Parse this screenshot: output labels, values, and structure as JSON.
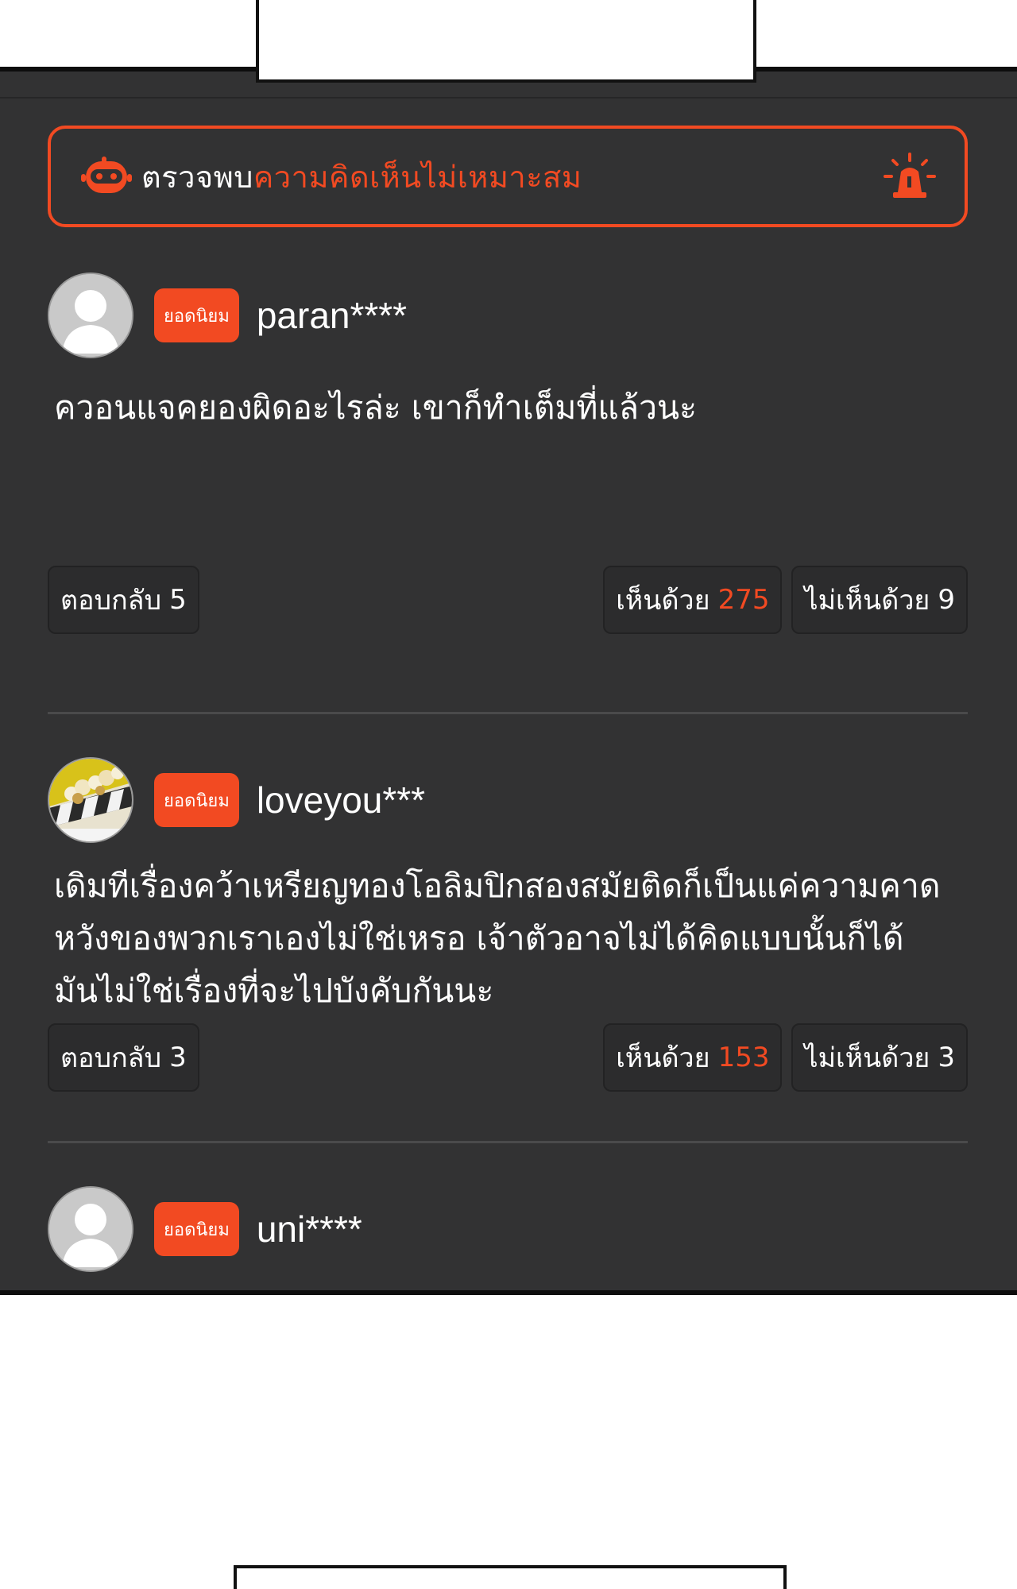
{
  "warning": {
    "prefix": "ตรวจพบ",
    "highlight": "ความคิดเห็นไม่เหมาะสม",
    "robot_icon": "robot-icon",
    "siren_icon": "siren-icon"
  },
  "comments": [
    {
      "avatar": "default-avatar",
      "badge": "ยอดนิยม",
      "username": "paran****",
      "text": "ควอนแจคยองผิดอะไรล่ะ เขาก็ทำเต็มที่แล้วนะ",
      "reply_label": "ตอบกลับ",
      "reply_count": "5",
      "agree_label": "เห็นด้วย",
      "agree_count": "275",
      "disagree_label": "ไม่เห็นด้วย",
      "disagree_count": "9"
    },
    {
      "avatar": "popcorn-clapperboard-avatar",
      "badge": "ยอดนิยม",
      "username": "loveyou***",
      "text": "เดิมทีเรื่องคว้าเหรียญทองโอลิมปิกสองสมัยติดก็เป็นแค่ความคาดหวังของพวกเราเองไม่ใช่เหรอ เจ้าตัวอาจไม่ได้คิดแบบนั้นก็ได้ มันไม่ใช่เรื่องที่จะไปบังคับกันนะ",
      "reply_label": "ตอบกลับ",
      "reply_count": "3",
      "agree_label": "เห็นด้วย",
      "agree_count": "153",
      "disagree_label": "ไม่เห็นด้วย",
      "disagree_count": "3"
    },
    {
      "avatar": "default-avatar",
      "badge": "ยอดนิยม",
      "username": "uni****"
    }
  ],
  "colors": {
    "accent": "#f24a22",
    "panel": "#323233",
    "text": "#ffffff"
  }
}
